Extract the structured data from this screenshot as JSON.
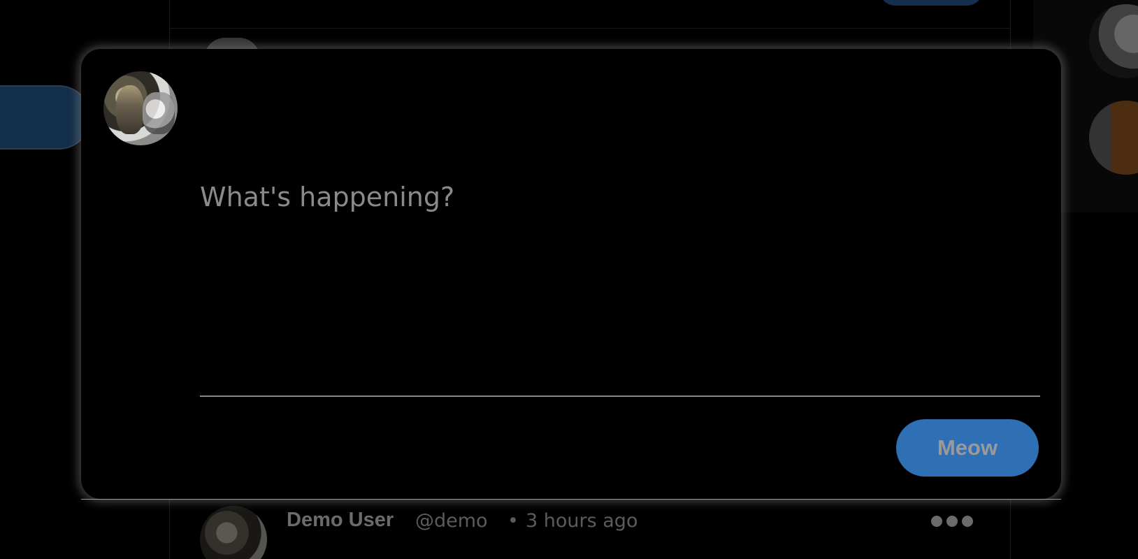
{
  "compose": {
    "placeholder": "What's happening?",
    "submit_label": "Meow",
    "accent_color": "#2f6fb3"
  },
  "icons": {
    "post_menu": "more-horizontal-icon"
  },
  "feed": {
    "visible_post": {
      "display_name": "Demo User",
      "handle": "@demo",
      "separator": "•",
      "time": "3 hours ago"
    }
  }
}
